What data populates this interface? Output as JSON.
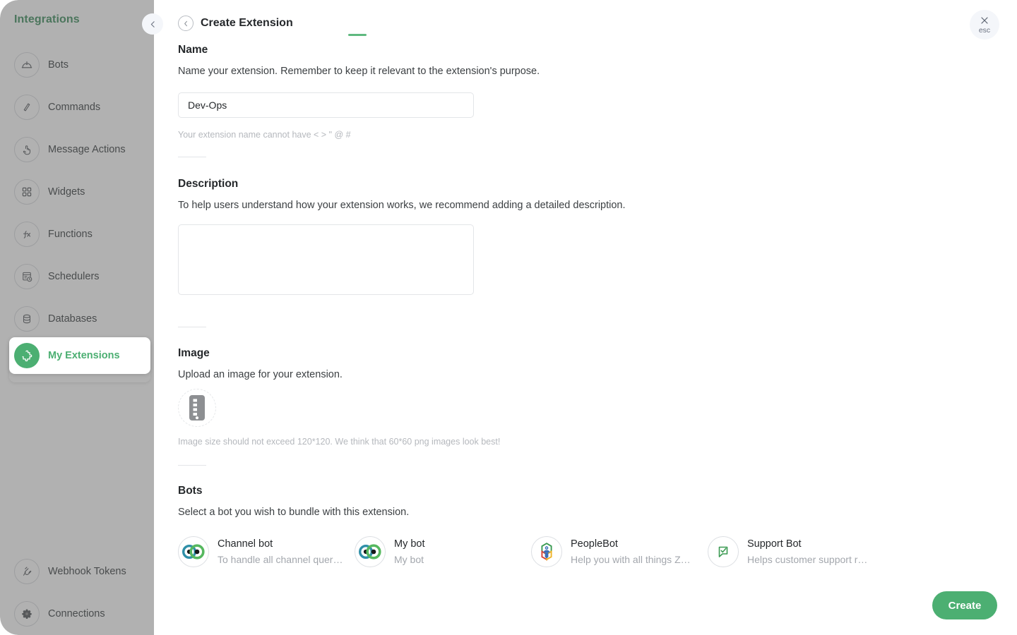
{
  "sidebar": {
    "title": "Integrations",
    "collapse_icon": "chevron-left-icon",
    "items": [
      {
        "label": "Bots",
        "icon": "bot-icon",
        "active": false
      },
      {
        "label": "Commands",
        "icon": "slash-icon",
        "active": false
      },
      {
        "label": "Message Actions",
        "icon": "pointer-hand-icon",
        "active": false
      },
      {
        "label": "Widgets",
        "icon": "grid-icon",
        "active": false
      },
      {
        "label": "Functions",
        "icon": "function-icon",
        "active": false
      },
      {
        "label": "Schedulers",
        "icon": "scheduler-clock-icon",
        "active": false
      },
      {
        "label": "Databases",
        "icon": "database-icon",
        "active": false
      },
      {
        "label": "My Extensions",
        "icon": "puzzle-icon",
        "active": true
      }
    ],
    "bottom_items": [
      {
        "label": "Webhook Tokens",
        "icon": "plug-icon"
      },
      {
        "label": "Connections",
        "icon": "gear-icon"
      }
    ]
  },
  "header": {
    "title": "Create Extension",
    "back_icon": "chevron-left-icon",
    "close_icon": "close-icon",
    "close_label": "esc"
  },
  "name_section": {
    "title": "Name",
    "description": "Name your extension. Remember to keep it relevant to the extension's purpose.",
    "value": "Dev-Ops",
    "placeholder": "",
    "hint": "Your extension name cannot have < > \" @ #"
  },
  "description_section": {
    "title": "Description",
    "description": "To help users understand how your extension works, we recommend adding a detailed description.",
    "value": "",
    "placeholder": ""
  },
  "image_section": {
    "title": "Image",
    "description": "Upload an image for your extension.",
    "upload_icon": "image-placeholder-icon",
    "hint": "Image size should not exceed 120*120. We think that 60*60 png images look best!"
  },
  "bots_section": {
    "title": "Bots",
    "description": "Select a bot you wish to bundle with this extension.",
    "bots": [
      {
        "name": "Channel bot",
        "sub": "To handle all channel quer…",
        "icon": "eyes-bot-icon"
      },
      {
        "name": "My bot",
        "sub": "My bot",
        "icon": "eyes-bot-icon"
      },
      {
        "name": "PeopleBot",
        "sub": "Help you with all things Z…",
        "icon": "people-hex-icon"
      },
      {
        "name": "Support Bot",
        "sub": "Helps customer support r…",
        "icon": "chat-check-icon"
      }
    ]
  },
  "footer": {
    "create_label": "Create"
  },
  "colors": {
    "accent_green": "#4CAF72",
    "title_green": "#3f8f5f",
    "underline_green": "#5fb97f",
    "text_dark": "#25282b",
    "text_muted": "#a3a7ad",
    "border": "#e3e5e8",
    "overlay": "#5a5a5a"
  }
}
